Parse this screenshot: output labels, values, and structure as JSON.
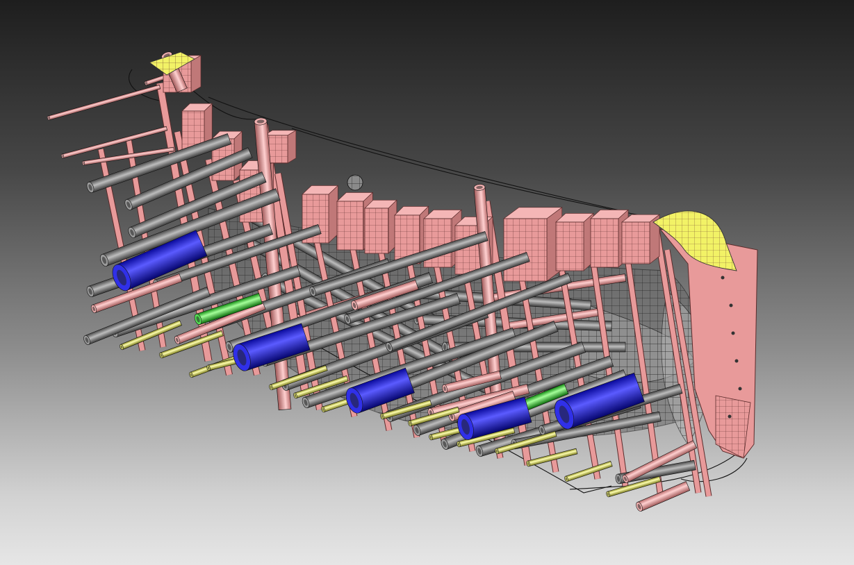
{
  "viewport": {
    "name": "3d-model-viewport",
    "background_top": "#1e1e1e",
    "background_bottom": "#e6e6e6"
  },
  "palette": {
    "structure_pink": "#e89a9a",
    "structure_stroke": "#5a2b2b",
    "pipe_gray": "#7d7d7d",
    "pipe_gray_light": "#bdbdbd",
    "pipe_blue": "#1414d9",
    "pipe_blue_light": "#5b5bff",
    "pipe_green": "#2ad42a",
    "pipe_green_light": "#a5ff9a",
    "pipe_yellow": "#e3e34a",
    "pipe_yellow_light": "#ffffb0",
    "bulkhead_yellow": "#f2f266",
    "mesh_dark": "#1a1a1a"
  }
}
